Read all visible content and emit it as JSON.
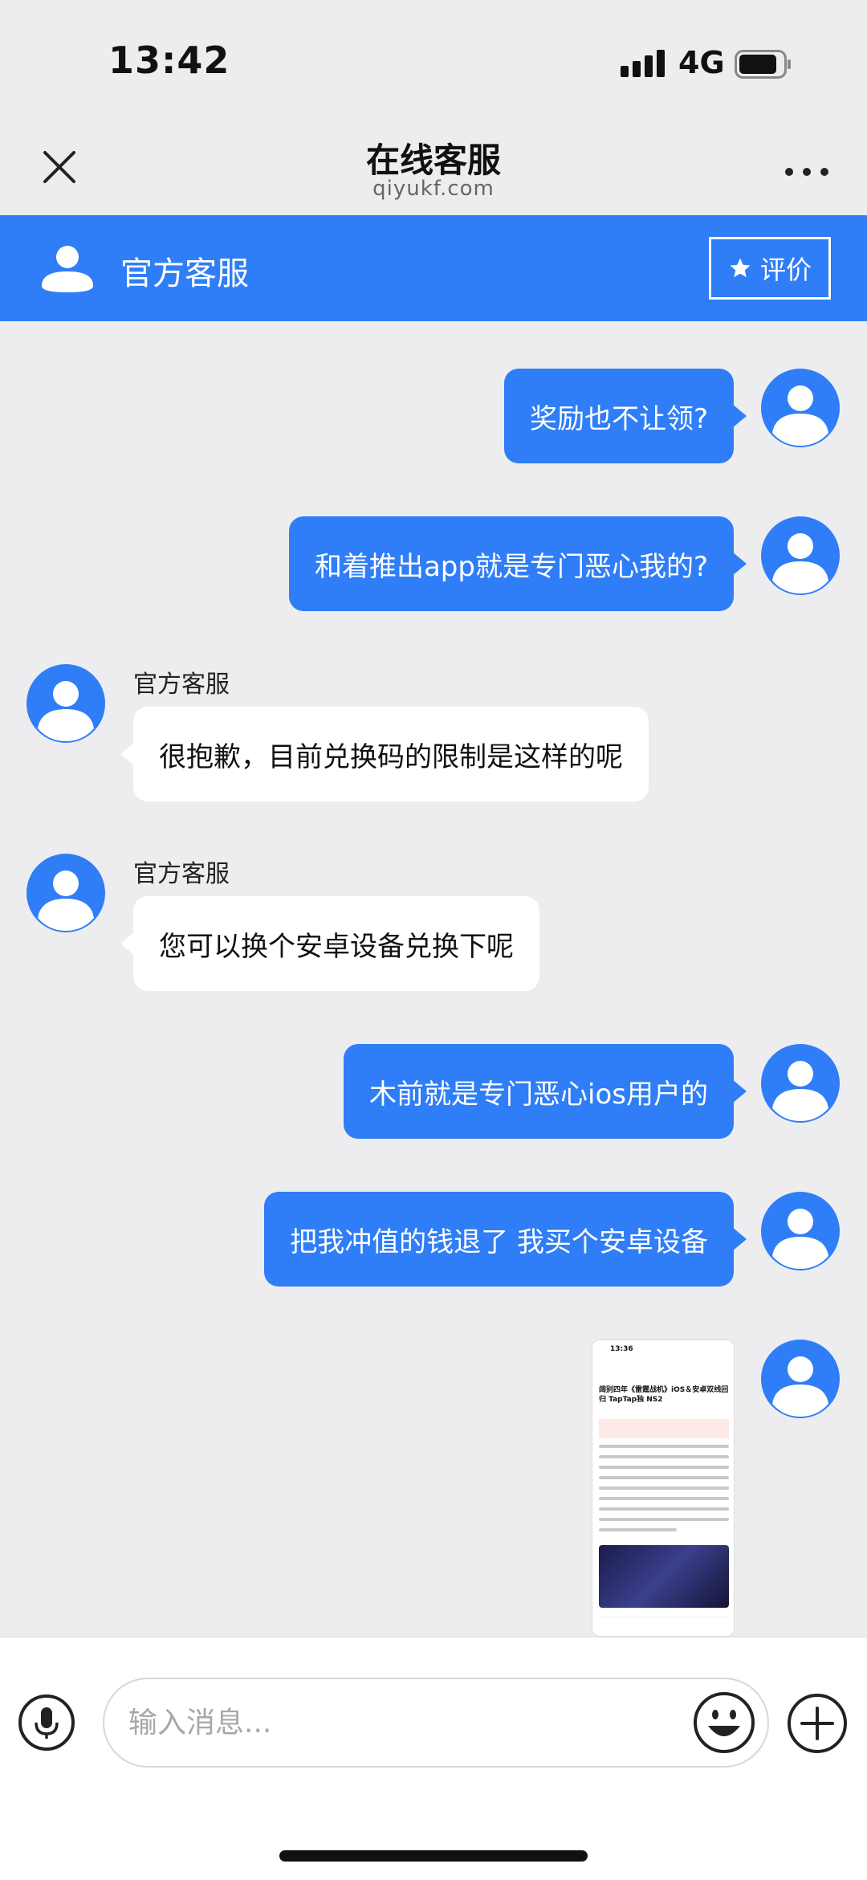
{
  "status_bar": {
    "time": "13:42",
    "network": "4G",
    "icons": [
      "signal-icon",
      "battery-icon"
    ]
  },
  "nav": {
    "title": "在线客服",
    "subtitle": "qiyukf.com",
    "icons": [
      "close-icon",
      "more-icon"
    ]
  },
  "agent_bar": {
    "name": "官方客服",
    "rate_label": "评价",
    "icons": [
      "avatar",
      "star-icon"
    ]
  },
  "messages": [
    {
      "dir": "out",
      "text": "奖励也不让领?"
    },
    {
      "dir": "out",
      "text": "和着推出app就是专门恶心我的?"
    },
    {
      "dir": "in",
      "sender": "官方客服",
      "text": "很抱歉，目前兑换码的限制是这样的呢"
    },
    {
      "dir": "in",
      "sender": "官方客服",
      "text": "您可以换个安卓设备兑换下呢"
    },
    {
      "dir": "out",
      "text": "木前就是专门恶心ios用户的"
    },
    {
      "dir": "out",
      "text": "把我冲值的钱退了 我买个安卓设备"
    },
    {
      "dir": "out",
      "type": "image",
      "thumb_time": "13:36",
      "thumb_title": "阔别四年《雷霆战机》iOS＆安卓双线回归 TapTap独 NS2"
    }
  ],
  "input": {
    "placeholder": "输入消息..."
  },
  "colors": {
    "accent": "#2f7ef7",
    "background": "#ededf0",
    "incoming_bubble": "#ffffff"
  }
}
